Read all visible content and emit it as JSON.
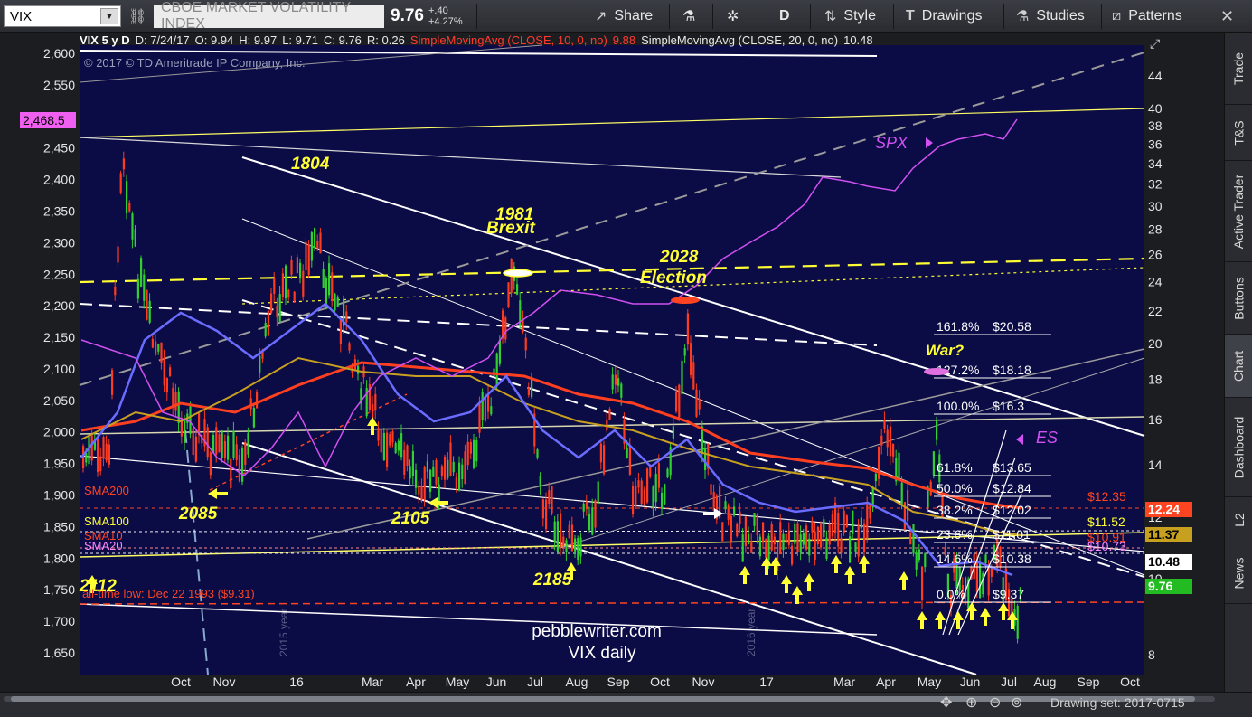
{
  "toolbar": {
    "symbol": "VIX",
    "instrument_name": "CBOE MARKET VOLATILITY INDEX",
    "last_price": "9.76",
    "net_change": "+.40",
    "pct_change": "+4.27%",
    "share_label": "Share",
    "period_label": "D",
    "style_label": "Style",
    "drawings_label": "Drawings",
    "studies_label": "Studies",
    "patterns_label": "Patterns"
  },
  "header": {
    "symbol_range": "VIX 5 y D",
    "date": "D: 7/24/17",
    "open": "O: 9.94",
    "high": "H: 9.97",
    "low": "L: 9.71",
    "close": "C: 9.76",
    "range": "R: 0.26",
    "sma10_label": "SimpleMovingAvg (CLOSE, 10, 0, no)",
    "sma10_value": "9.88",
    "sma20_label": "SimpleMovingAvg (CLOSE, 20, 0, no)",
    "sma20_value": "10.48",
    "copyright": "© 2017 © TD Ameritrade IP Company, Inc."
  },
  "sidebar": {
    "tabs": [
      "Trade",
      "T&S",
      "Active Trader",
      "Buttons",
      "Chart",
      "Dashboard",
      "L2",
      "News"
    ],
    "active_tab": "Chart"
  },
  "bottombar": {
    "drawing_set": "Drawing set: 2017-0715"
  },
  "annotations": {
    "level_1804": "1804",
    "level_1981": "1981",
    "brexit": "Brexit",
    "level_2028": "2028",
    "election": "Election",
    "level_2085": "2085",
    "level_2105": "2105",
    "level_2185": "2185",
    "level_2112": "2112",
    "spx": "SPX",
    "es": "ES",
    "war": "War?",
    "all_time_low": "all-time low: Dec 22 1993 ($9.31)",
    "watermark_site": "pebblewriter.com",
    "watermark_title": "VIX daily",
    "year_2015": "2015 year",
    "year_2016": "2016 year",
    "sma200_label": "SMA200",
    "sma100_label": "SMA100",
    "sma10_label": "SMA10",
    "sma20_label": "SMA20"
  },
  "fib_levels": [
    {
      "pct": "161.8%",
      "value": "$20.58"
    },
    {
      "pct": "127.2%",
      "value": "$18.18"
    },
    {
      "pct": "100.0%",
      "value": "$16.3"
    },
    {
      "pct": "61.8%",
      "value": "$13.65"
    },
    {
      "pct": "50.0%",
      "value": "$12.84"
    },
    {
      "pct": "38.2%",
      "value": "$12.02"
    },
    {
      "pct": "23.6%",
      "value": "$11.01"
    },
    {
      "pct": "14.6%",
      "value": "$10.38"
    },
    {
      "pct": "0.0%",
      "value": "$9.37"
    }
  ],
  "price_boxes": {
    "spx_current": "2,468.5",
    "sma200": "12.24",
    "sma200_line": "$12.35",
    "sma100": "11.37",
    "sma100_line": "$11.52",
    "sma10_line": "$10.73",
    "sma10_line_b": "$10.91",
    "sma20": "10.48",
    "last": "9.76"
  },
  "colors": {
    "background": "#0b0b45",
    "candle_up": "#2fd02f",
    "candle_down": "#ff3b1f",
    "sma200": "#ff4020",
    "sma100": "#c8a020",
    "sma50": "#6a6cff",
    "spx_line": "#d050f0",
    "annotation_yellow": "#ffff33"
  },
  "chart_data": {
    "type": "candlestick",
    "title": "VIX daily",
    "left_axis_ticks": [
      "2,600",
      "2,550",
      "2,500",
      "2,450",
      "2,400",
      "2,350",
      "2,300",
      "2,250",
      "2,200",
      "2,150",
      "2,100",
      "2,050",
      "2,000",
      "1,950",
      "1,900",
      "1,850",
      "1,800",
      "1,750",
      "1,700",
      "1,650"
    ],
    "right_axis_ticks": [
      "44",
      "40",
      "38",
      "36",
      "34",
      "32",
      "30",
      "28",
      "26",
      "24",
      "22",
      "20",
      "18",
      "16",
      "14",
      "12",
      "10",
      "8"
    ],
    "x_ticks": [
      "Oct",
      "Nov",
      "16",
      "Mar",
      "Apr",
      "May",
      "Jun",
      "Jul",
      "Aug",
      "Sep",
      "Oct",
      "Nov",
      "17",
      "Mar",
      "Apr",
      "May",
      "Jun",
      "Jul",
      "Aug",
      "Sep",
      "Oct"
    ],
    "series": [
      {
        "name": "SPX",
        "values": [
          2100,
          2080,
          1980,
          1920,
          1870,
          2040,
          2080,
          2100,
          2170,
          2180,
          2140,
          2200,
          2270,
          2370,
          2360,
          2400,
          2440,
          2460,
          2468.5
        ]
      },
      {
        "name": "SimpleMovingAvg (CLOSE, 10, 0, no)",
        "last": 9.88
      },
      {
        "name": "SimpleMovingAvg (CLOSE, 20, 0, no)",
        "last": 10.48
      }
    ],
    "last_close": 9.76
  }
}
